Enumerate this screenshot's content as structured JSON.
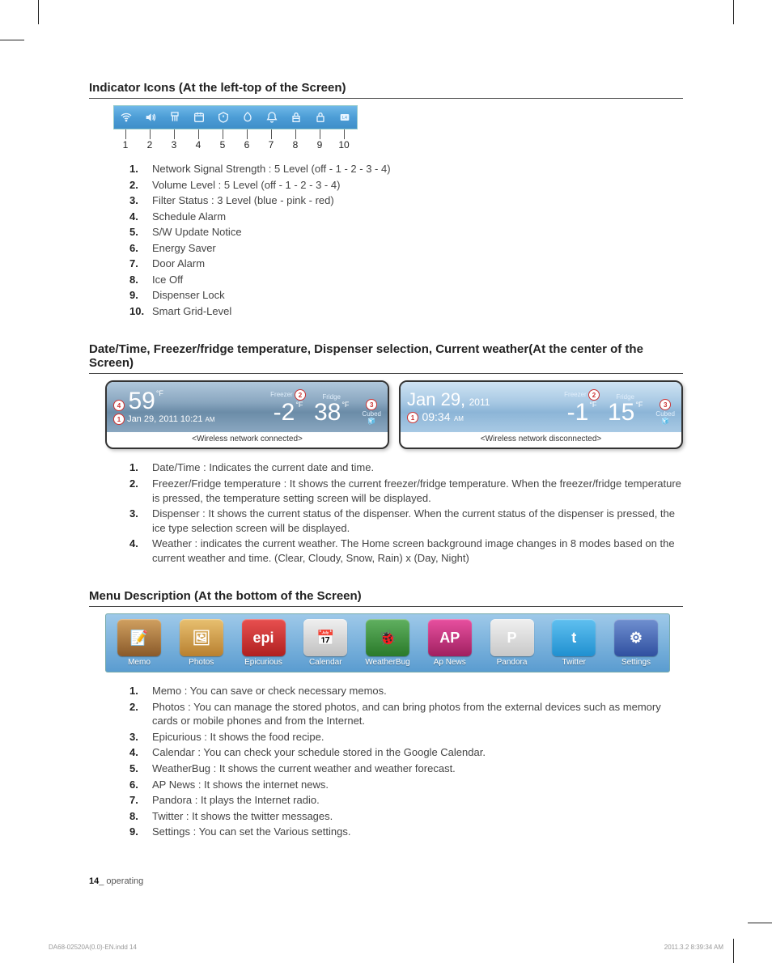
{
  "sections": {
    "indicator": {
      "title": "Indicator Icons (At the left-top of the Screen)",
      "icons": [
        {
          "num": "1",
          "name": "wifi-icon"
        },
        {
          "num": "2",
          "name": "volume-icon"
        },
        {
          "num": "3",
          "name": "filter-icon"
        },
        {
          "num": "4",
          "name": "schedule-alarm-icon"
        },
        {
          "num": "5",
          "name": "sw-update-icon"
        },
        {
          "num": "6",
          "name": "energy-saver-icon"
        },
        {
          "num": "7",
          "name": "door-alarm-icon"
        },
        {
          "num": "8",
          "name": "ice-off-icon"
        },
        {
          "num": "9",
          "name": "dispenser-lock-icon"
        },
        {
          "num": "10",
          "name": "smart-grid-icon"
        }
      ],
      "items": [
        "Network Signal Strength : 5 Level (off - 1 - 2 - 3 - 4)",
        "Volume Level : 5 Level (off - 1 - 2 - 3 - 4)",
        "Filter Status : 3 Level (blue - pink - red)",
        "Schedule Alarm",
        "S/W Update Notice",
        "Energy Saver",
        "Door Alarm",
        "Ice Off",
        "Dispenser Lock",
        "Smart Grid-Level"
      ]
    },
    "center": {
      "title": "Date/Time, Freezer/fridge temperature, Dispenser selection, Current weather(At the center of the Screen)",
      "panel_connected": {
        "caption": "<Wireless network connected>",
        "weather_temp": "59",
        "weather_unit": "°F",
        "date_line": "Jan 29, 2011 10:21",
        "ampm": "AM",
        "freezer_label": "Freezer",
        "freezer_temp": "-2",
        "fridge_label": "Fridge",
        "fridge_temp": "38",
        "temp_unit": "°F",
        "dispenser": "Cubed"
      },
      "panel_disconnected": {
        "caption": "<Wireless network disconnected>",
        "date_big": "Jan 29,",
        "year": "2011",
        "time": "09:34",
        "ampm": "AM",
        "freezer_label": "Freezer",
        "freezer_temp": "-1",
        "fridge_label": "Fridge",
        "fridge_temp": "15",
        "temp_unit": "°F",
        "dispenser": "Cubed"
      },
      "items": [
        "Date/Time : Indicates the current date and time.",
        "Freezer/Fridge temperature : It shows the current freezer/fridge temperature. When the freezer/fridge temperature is pressed, the temperature setting screen will be displayed.",
        "Dispenser : It shows the current status of the dispenser. When the current status of the dispenser is pressed, the ice type selection screen will be displayed.",
        "Weather : indicates the current weather. The Home screen background image changes in 8 modes based on the current weather and time. (Clear, Cloudy, Snow, Rain) x (Day, Night)"
      ]
    },
    "menu": {
      "title": "Menu Description (At the bottom of the Screen)",
      "apps": [
        {
          "label": "Memo",
          "cls": "ic-memo",
          "glyph": "📝"
        },
        {
          "label": "Photos",
          "cls": "ic-photos",
          "glyph": "🖼"
        },
        {
          "label": "Epicurious",
          "cls": "ic-epi",
          "glyph": "epi"
        },
        {
          "label": "Calendar",
          "cls": "ic-cal",
          "glyph": "📅"
        },
        {
          "label": "WeatherBug",
          "cls": "ic-weather",
          "glyph": "🐞"
        },
        {
          "label": "Ap News",
          "cls": "ic-ap",
          "glyph": "AP"
        },
        {
          "label": "Pandora",
          "cls": "ic-pandora",
          "glyph": "P"
        },
        {
          "label": "Twitter",
          "cls": "ic-twitter",
          "glyph": "t"
        },
        {
          "label": "Settings",
          "cls": "ic-settings",
          "glyph": "⚙"
        }
      ],
      "items": [
        "Memo : You can save or check necessary memos.",
        "Photos : You can manage the stored photos, and can bring photos from the external devices such as memory cards or mobile phones and from the Internet.",
        "Epicurious : It shows the food recipe.",
        "Calendar : You can check your schedule stored in the Google Calendar.",
        "WeatherBug : It shows the current weather and weather forecast.",
        "AP News : It shows the internet news.",
        "Pandora : It plays the Internet radio.",
        "Twitter : It shows the twitter messages.",
        "Settings : You can set the Various settings."
      ]
    }
  },
  "footer": {
    "page_num": "14",
    "page_label": "_ operating",
    "meta_left": "DA68-02520A(0.0)-EN.indd   14",
    "meta_right": "2011.3.2   8:39:34 AM"
  },
  "badges": {
    "b1": "1",
    "b2": "2",
    "b3": "3",
    "b4": "4"
  }
}
